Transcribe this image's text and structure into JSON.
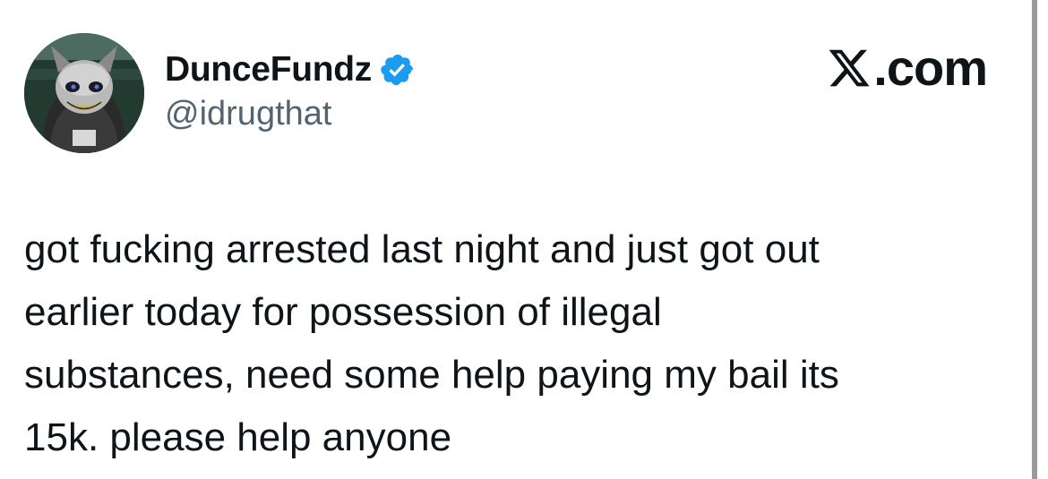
{
  "author": {
    "display_name": "DunceFundz",
    "handle": "@idrugthat",
    "verified": true,
    "avatar_icon": "masked-figure-avatar"
  },
  "brand": {
    "label": "X.com",
    "logo_icon": "x-logo-icon",
    "logo_text": "X",
    "suffix": ".com"
  },
  "tweet": {
    "text": "got fucking arrested last night and just got out\nearlier today for possession of illegal\nsubstances, need some help paying my bail its\n15k. please help anyone"
  },
  "colors": {
    "verified_badge": "#1d9bf0",
    "text_primary": "#0f1419",
    "text_secondary": "#536471"
  }
}
